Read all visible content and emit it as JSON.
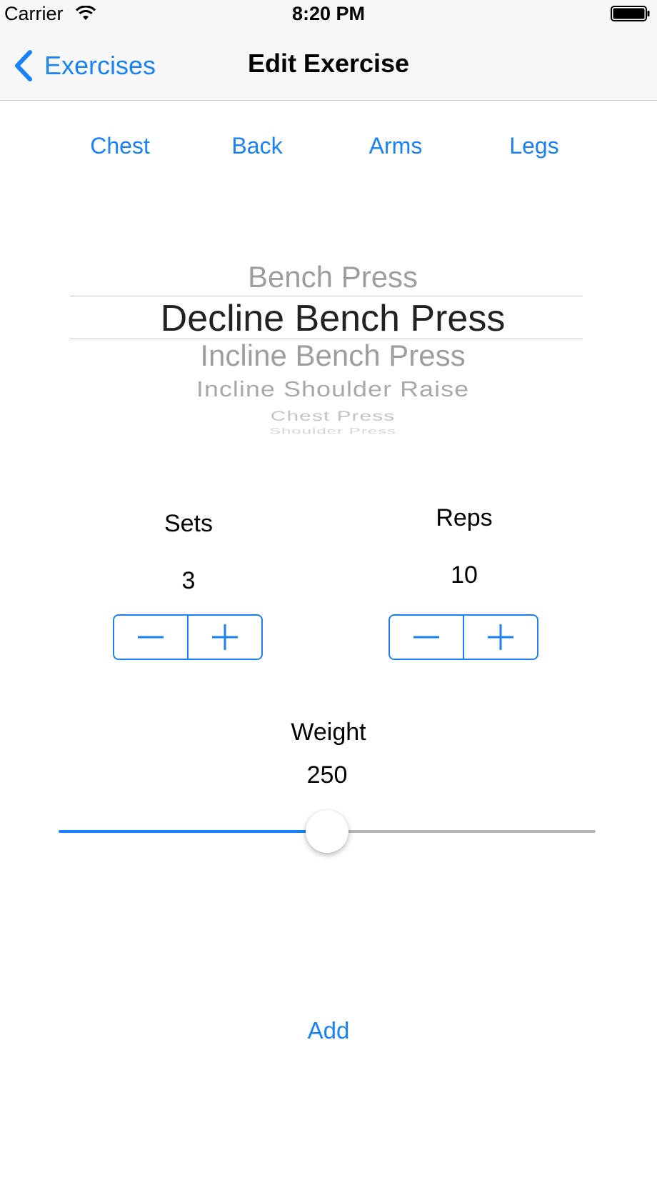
{
  "status_bar": {
    "carrier": "Carrier",
    "time": "8:20 PM",
    "icons": [
      "wifi-icon",
      "battery-icon"
    ]
  },
  "nav": {
    "back_label": "Exercises",
    "title": "Edit Exercise"
  },
  "categories": [
    "Chest",
    "Back",
    "Arms",
    "Legs"
  ],
  "picker": {
    "above": "Bench Press",
    "selected": "Decline Bench Press",
    "below": [
      "Incline Bench Press",
      "Incline Shoulder Raise",
      "Chest Press",
      "Shoulder Press"
    ]
  },
  "sets": {
    "label": "Sets",
    "value": "3",
    "decrement_icon": "minus-icon",
    "increment_icon": "plus-icon"
  },
  "reps": {
    "label": "Reps",
    "value": "10",
    "decrement_icon": "minus-icon",
    "increment_icon": "plus-icon"
  },
  "weight": {
    "label": "Weight",
    "value": "250",
    "slider_fraction": 0.5
  },
  "add_label": "Add",
  "colors": {
    "accent": "#1a82f7",
    "picker_dim": "#9e9e9e",
    "picker_selected": "#222222"
  }
}
